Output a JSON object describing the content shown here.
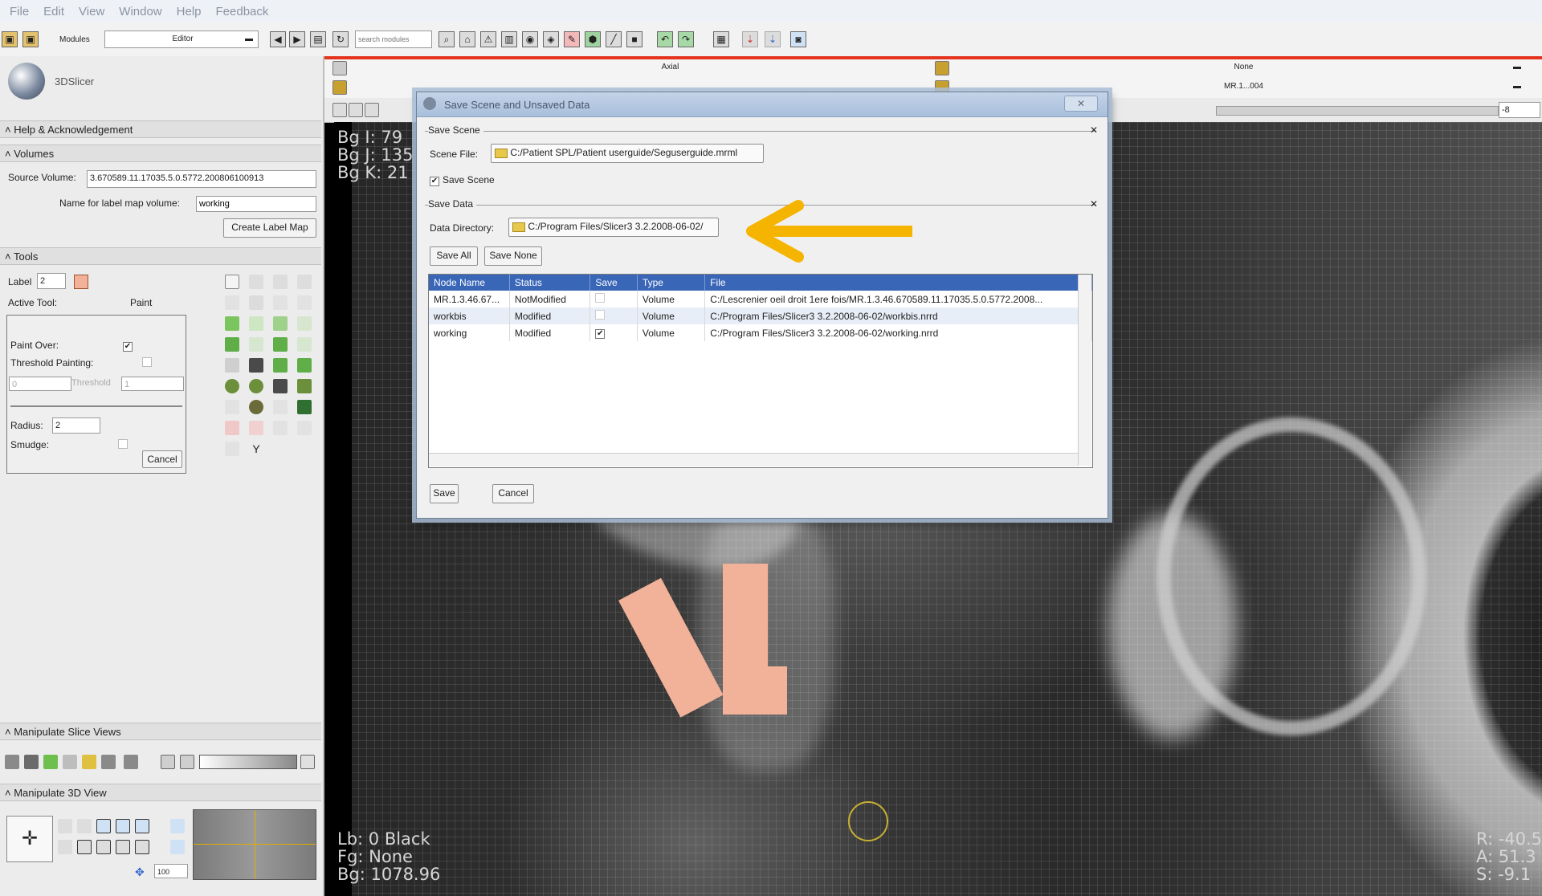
{
  "menu": [
    "File",
    "Edit",
    "View",
    "Window",
    "Help",
    "Feedback"
  ],
  "toolbar": {
    "modules_label": "Modules",
    "module_selected": "Editor",
    "search_placeholder": "search modules"
  },
  "logo_text": "3DSlicer",
  "sections": {
    "help": "Help & Acknowledgement",
    "volumes": "Volumes",
    "tools": "Tools",
    "slice_views": "Manipulate Slice Views",
    "view3d": "Manipulate 3D View"
  },
  "volumes": {
    "source_label": "Source Volume:",
    "source_value": "3.670589.11.17035.5.0.5772.200806100913",
    "labelmap_name_label": "Name for label map volume:",
    "labelmap_name_value": "working",
    "create_button": "Create Label Map"
  },
  "tools": {
    "label_label": "Label",
    "label_value": "2",
    "active_tool_label": "Active Tool:",
    "active_tool_value": "Paint",
    "paint_over": "Paint Over:",
    "threshold_painting": "Threshold Painting:",
    "threshold_min": "0",
    "threshold_text": "Threshold",
    "threshold_max": "1",
    "radius_label": "Radius:",
    "radius_value": "2",
    "smudge": "Smudge:",
    "cancel": "Cancel"
  },
  "view3d": {
    "zoom_value": "100"
  },
  "slice": {
    "orientation": "Axial",
    "fg": "None",
    "bg": "MR.1...004",
    "offset": "-8"
  },
  "overlay": {
    "bg_i": "Bg I: 79",
    "bg_j": "Bg J: 135",
    "bg_k": "Bg K: 21",
    "lb": "Lb: 0 Black",
    "fg": "Fg: None",
    "bgval": "Bg: 1078.96",
    "r": "R: -40.5",
    "a": "A: 51.3",
    "s": "S: -9.1"
  },
  "dialog": {
    "title": "Save Scene and Unsaved Data",
    "save_scene_group": "Save Scene",
    "scene_file_label": "Scene File:",
    "scene_file_value": "C:/Patient SPL/Patient userguide/Seguserguide.mrml",
    "save_scene_check": "Save Scene",
    "save_data_group": "Save Data",
    "data_dir_label": "Data Directory:",
    "data_dir_value": "C:/Program Files/Slicer3 3.2.2008-06-02/",
    "save_all": "Save All",
    "save_none": "Save None",
    "columns": [
      "Node Name",
      "Status",
      "Save",
      "Type",
      "File"
    ],
    "rows": [
      {
        "name": "MR.1.3.46.67...",
        "status": "NotModified",
        "save": false,
        "type": "Volume",
        "file": "C:/Lescrenier oeil droit 1ere fois/MR.1.3.46.670589.11.17035.5.0.5772.2008..."
      },
      {
        "name": "workbis",
        "status": "Modified",
        "save": false,
        "type": "Volume",
        "file": "C:/Program Files/Slicer3 3.2.2008-06-02/workbis.nrrd"
      },
      {
        "name": "working",
        "status": "Modified",
        "save": true,
        "type": "Volume",
        "file": "C:/Program Files/Slicer3 3.2.2008-06-02/working.nrrd"
      }
    ],
    "save": "Save",
    "cancel": "Cancel"
  },
  "colors": {
    "accent": "#f5b400",
    "selection": "#3a66b8",
    "label_paint": "#f2b299",
    "red_bar": "#e4341f"
  }
}
